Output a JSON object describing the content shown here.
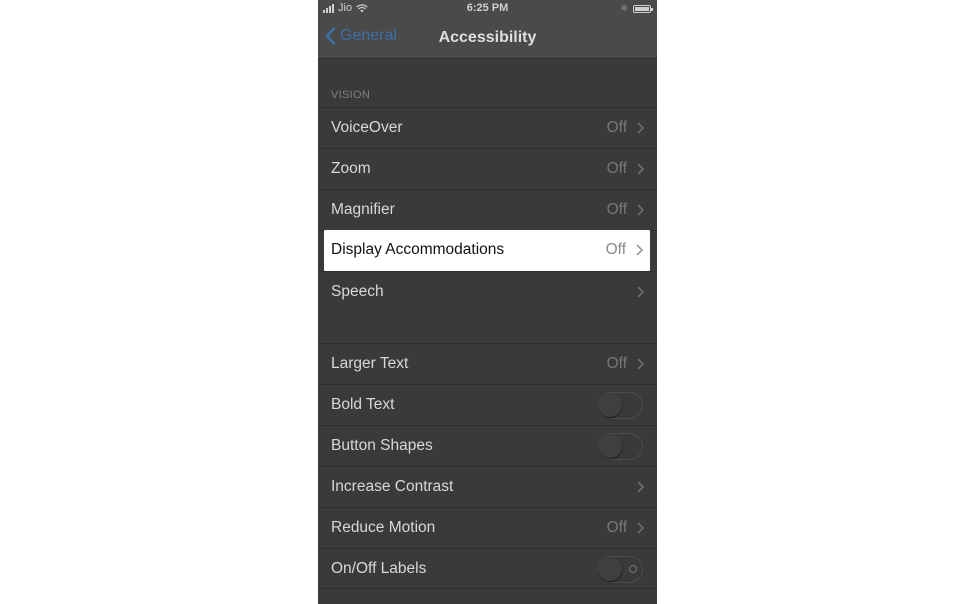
{
  "statusbar": {
    "carrier": "Jio",
    "time": "6:25 PM",
    "bluetooth_icon": "bluetooth-icon",
    "battery_icon": "battery-icon"
  },
  "navbar": {
    "back_label": "General",
    "title": "Accessibility"
  },
  "colors": {
    "accent": "#3d6fa8",
    "background": "#3a3a3a",
    "highlight": "#ffffff"
  },
  "vision": {
    "header": "VISION",
    "rows": [
      {
        "label": "VoiceOver",
        "value": "Off"
      },
      {
        "label": "Zoom",
        "value": "Off"
      },
      {
        "label": "Magnifier",
        "value": "Off"
      },
      {
        "label": "Display Accommodations",
        "value": "Off"
      },
      {
        "label": "Speech",
        "value": ""
      }
    ]
  },
  "interaction": {
    "rows": [
      {
        "label": "Larger Text",
        "value": "Off"
      },
      {
        "label": "Bold Text",
        "toggle": false
      },
      {
        "label": "Button Shapes",
        "toggle": false
      },
      {
        "label": "Increase Contrast",
        "value": ""
      },
      {
        "label": "Reduce Motion",
        "value": "Off"
      },
      {
        "label": "On/Off Labels",
        "toggle": false
      }
    ]
  }
}
